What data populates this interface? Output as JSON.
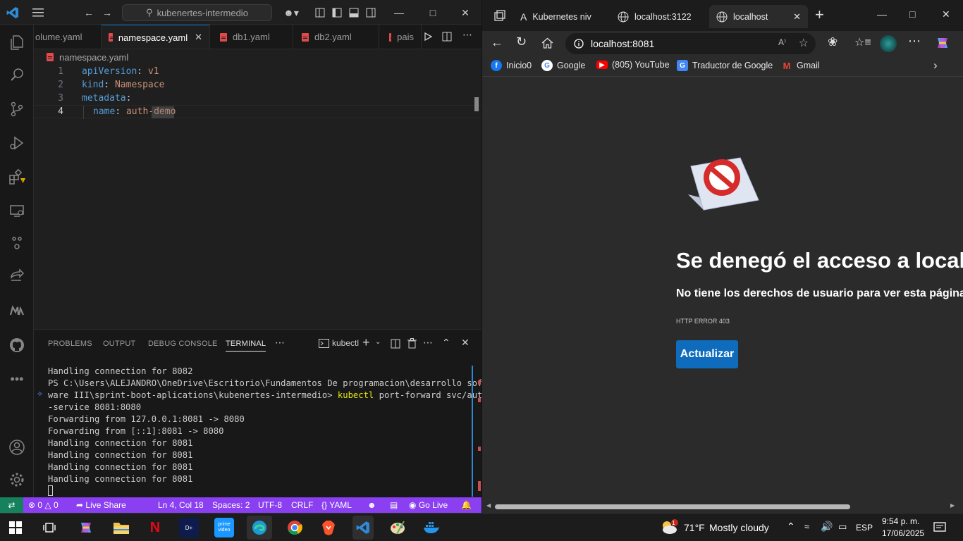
{
  "vscode": {
    "search": "kubenertes-intermedio",
    "tabs": [
      "olume.yaml",
      "namespace.yaml",
      "db1.yaml",
      "db2.yaml",
      "pais"
    ],
    "breadcrumb": "namespace.yaml",
    "code_lines": [
      {
        "num": "1",
        "key": "apiVersion",
        "sep": ": ",
        "val": "v1"
      },
      {
        "num": "2",
        "key": "kind",
        "sep": ": ",
        "val": "Namespace"
      },
      {
        "num": "3",
        "key": "metadata",
        "sep": ":",
        "val": ""
      },
      {
        "num": "4",
        "key": "name",
        "sep": ": ",
        "val": "auth-demo"
      }
    ],
    "panel_tabs": [
      "PROBLEMS",
      "OUTPUT",
      "DEBUG CONSOLE",
      "TERMINAL"
    ],
    "terminal_name": "kubectl",
    "terminal_lines": [
      "Handling connection for 8082",
      "PS C:\\Users\\ALEJANDRO\\OneDrive\\Escritorio\\Fundamentos De programacion\\desarrollo soft",
      "ware III\\sprint-boot-aplications\\kubenertes-intermedio>",
      "-service 8081:8080",
      "Forwarding from 127.0.0.1:8081 -> 8080",
      "Forwarding from [::1]:8081 -> 8080",
      "Handling connection for 8081",
      "Handling connection for 8081",
      "Handling connection for 8081",
      "Handling connection for 8081"
    ],
    "terminal_cmd": "kubectl",
    "terminal_cmd_rest": " port-forward svc/auth",
    "status": {
      "errors": "0",
      "warnings": "0",
      "live_share": "Live Share",
      "position": "Ln 4, Col 18",
      "spaces": "Spaces: 2",
      "encoding": "UTF-8",
      "eol": "CRLF",
      "language": "YAML",
      "go_live": "Go Live"
    }
  },
  "browser": {
    "tabs": [
      "Kubernetes niv",
      "localhost:3122",
      "localhost"
    ],
    "url": "localhost:8081",
    "favorites": [
      "Inicio0",
      "Google",
      "(805) YouTube",
      "Traductor de Google",
      "Gmail"
    ],
    "error_title": "Se denegó el acceso a localh",
    "error_subtitle": "No tiene los derechos de usuario para ver esta página.",
    "error_code": "HTTP ERROR 403",
    "reload_button": "Actualizar"
  },
  "taskbar": {
    "weather_temp": "71°F",
    "weather_desc": "Mostly cloudy",
    "weather_badge": "1",
    "language": "ESP",
    "time": "9:54 p. m.",
    "date": "17/06/2025"
  },
  "colors": {
    "statusbar": "#8a3ff0",
    "accent": "#0078d4",
    "reload_button": "#0f6cbd"
  }
}
